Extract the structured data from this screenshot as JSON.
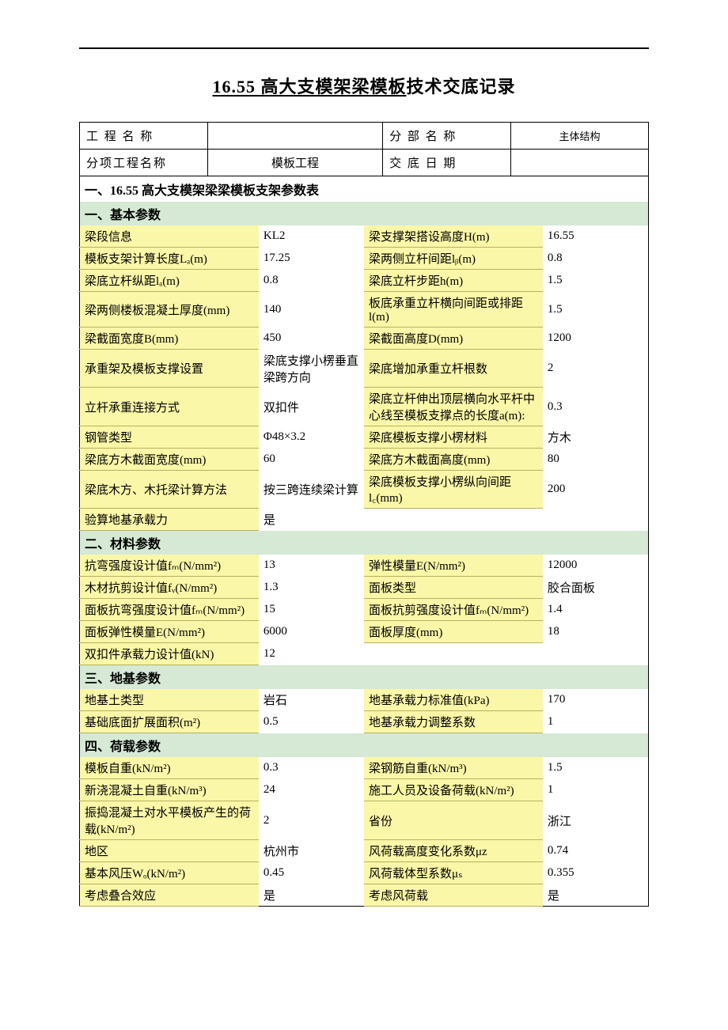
{
  "title_underline": "16.55 高大支模架梁模板",
  "title_rest": "技术交底记录",
  "header": {
    "r1c1_label": "工 程 名 称",
    "r1c1_value": "",
    "r1c2_label": "分 部 名 称",
    "r1c2_value": "主体结构",
    "r2c1_label": "分项工程名称",
    "r2c1_value": "模板工程",
    "r2c2_label": "交 底 日 期",
    "r2c2_value": ""
  },
  "section_title": "一、16.55 高大支模架梁梁模板支架参数表",
  "groups": [
    {
      "title": "一、基本参数",
      "rows": [
        {
          "k1": "梁段信息",
          "v1": "KL2",
          "k2": "梁支撑架搭设高度H(m)",
          "v2": "16.55"
        },
        {
          "k1": "模板支架计算长度Lₐ(m)",
          "v1": "17.25",
          "k2": "梁两侧立杆间距lᵦ(m)",
          "v2": "0.8"
        },
        {
          "k1": "梁底立杆纵距lₐ(m)",
          "v1": "0.8",
          "k2": "梁底立杆步距h(m)",
          "v2": "1.5"
        },
        {
          "k1": "梁两侧楼板混凝土厚度(mm)",
          "v1": "140",
          "k2": "板底承重立杆横向间距或排距l(m)",
          "v2": "1.5"
        },
        {
          "k1": "梁截面宽度B(mm)",
          "v1": "450",
          "k2": "梁截面高度D(mm)",
          "v2": "1200"
        },
        {
          "k1": "承重架及模板支撑设置",
          "v1": "梁底支撑小楞垂直梁跨方向",
          "k2": "梁底增加承重立杆根数",
          "v2": "2"
        },
        {
          "k1": "立杆承重连接方式",
          "v1": "双扣件",
          "k2": "梁底立杆伸出顶层横向水平杆中心线至模板支撑点的长度a(m):",
          "v2": "0.3"
        },
        {
          "k1": "钢管类型",
          "v1": "Φ48×3.2",
          "k2": "梁底模板支撑小楞材料",
          "v2": "方木"
        },
        {
          "k1": "梁底方木截面宽度(mm)",
          "v1": "60",
          "k2": "梁底方木截面高度(mm)",
          "v2": "80"
        },
        {
          "k1": "梁底木方、木托梁计算方法",
          "v1": "按三跨连续梁计算",
          "k2": "梁底模板支撑小楞纵向间距l꜀(mm)",
          "v2": "200"
        },
        {
          "k1": "验算地基承载力",
          "v1": "是",
          "k2": "",
          "v2": ""
        }
      ]
    },
    {
      "title": "二、材料参数",
      "rows": [
        {
          "k1": "抗弯强度设计值fₘ(N/mm²)",
          "v1": "13",
          "k2": "弹性模量E(N/mm²)",
          "v2": "12000"
        },
        {
          "k1": "木材抗剪设计值fᵥ(N/mm²)",
          "v1": "1.3",
          "k2": "面板类型",
          "v2": "胶合面板"
        },
        {
          "k1": "面板抗弯强度设计值fₘ(N/mm²)",
          "v1": "15",
          "k2": "面板抗剪强度设计值fₘ(N/mm²)",
          "v2": "1.4"
        },
        {
          "k1": "面板弹性模量E(N/mm²)",
          "v1": "6000",
          "k2": "面板厚度(mm)",
          "v2": "18"
        },
        {
          "k1": "双扣件承载力设计值(kN)",
          "v1": "12",
          "k2": "",
          "v2": ""
        }
      ]
    },
    {
      "title": "三、地基参数",
      "rows": [
        {
          "k1": "地基土类型",
          "v1": "岩石",
          "k2": "地基承载力标准值(kPa)",
          "v2": "170"
        },
        {
          "k1": "基础底面扩展面积(m²)",
          "v1": "0.5",
          "k2": "地基承载力调整系数",
          "v2": "1"
        }
      ]
    },
    {
      "title": "四、荷载参数",
      "rows": [
        {
          "k1": "模板自重(kN/m²)",
          "v1": "0.3",
          "k2": "梁钢筋自重(kN/m³)",
          "v2": "1.5"
        },
        {
          "k1": "新浇混凝土自重(kN/m³)",
          "v1": "24",
          "k2": "施工人员及设备荷载(kN/m²)",
          "v2": "1"
        },
        {
          "k1": "振捣混凝土对水平模板产生的荷载(kN/m²)",
          "v1": "2",
          "k2": "省份",
          "v2": "浙江"
        },
        {
          "k1": "地区",
          "v1": "杭州市",
          "k2": "风荷载高度变化系数μz",
          "v2": "0.74"
        },
        {
          "k1": "基本风压Wₒ(kN/m²)",
          "v1": "0.45",
          "k2": "风荷载体型系数μₛ",
          "v2": "0.355"
        },
        {
          "k1": "考虑叠合效应",
          "v1": "是",
          "k2": "考虑风荷载",
          "v2": "是"
        }
      ]
    }
  ]
}
